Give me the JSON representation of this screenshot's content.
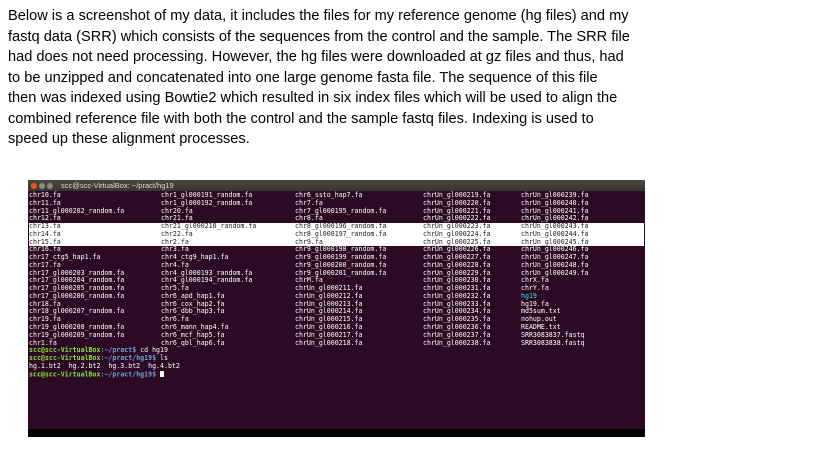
{
  "document": {
    "lines": [
      "Below is a screenshot of my data, it includes the files for my reference genome (hg files) and my",
      "fastq data (SRR) which consists of the sequences from the control and the sample. The SRR file",
      "had does not need processing.  However, the hg files were downloaded at gz files and thus, had",
      "to be unzipped and concatenated into one large genome fasta file.  The sequence of this file",
      "then was indexed using Bowtie2 which resulted in six index files which will be used to align the",
      "combined reference file with both the control and the sample fastq files.  Indexing is used to",
      "speed up these alignment processes."
    ]
  },
  "terminal": {
    "title": "scc@scc-VirtualBox: ~/pract/hg19",
    "rows": [
      [
        "chr10.fa",
        "chr1_gl000191_random.fa",
        "chr6_ssto_hap7.fa",
        "chrUn_gl000219.fa",
        "chrUn_gl000239.fa"
      ],
      [
        "chr11.fa",
        "chr1_gl000192_random.fa",
        "chr7.fa",
        "chrUn_gl000220.fa",
        "chrUn_gl000240.fa"
      ],
      [
        "chr11_gl000202_random.fa",
        "chr20.fa",
        "chr7_gl000195_random.fa",
        "chrUn_gl000221.fa",
        "chrUn_gl000241.fa"
      ],
      [
        "chr12.fa",
        "chr21.fa",
        "chr8.fa",
        "chrUn_gl000222.fa",
        "chrUn_gl000242.fa"
      ],
      [
        "chr13.fa",
        "chr21_gl000210_random.fa",
        "chr8_gl000196_random.fa",
        "chrUn_gl000223.fa",
        "chrUn_gl000243.fa"
      ],
      [
        "chr14.fa",
        "chr22.fa",
        "chr8_gl000197_random.fa",
        "chrUn_gl000224.fa",
        "chrUn_gl000244.fa"
      ],
      [
        "chr15.fa",
        "chr2.fa",
        "chr9.fa",
        "chrUn_gl000225.fa",
        "chrUn_gl000245.fa"
      ],
      [
        "chr16.fa",
        "chr3.fa",
        "chr9_gl000198_random.fa",
        "chrUn_gl000226.fa",
        "chrUn_gl000246.fa"
      ],
      [
        "chr17_ctg5_hap1.fa",
        "chr4_ctg9_hap1.fa",
        "chr9_gl000199_random.fa",
        "chrUn_gl000227.fa",
        "chrUn_gl000247.fa"
      ],
      [
        "chr17.fa",
        "chr4.fa",
        "chr9_gl000200_random.fa",
        "chrUn_gl000228.fa",
        "chrUn_gl000248.fa"
      ],
      [
        "chr17_gl000203_random.fa",
        "chr4_gl000193_random.fa",
        "chr9_gl000201_random.fa",
        "chrUn_gl000229.fa",
        "chrUn_gl000249.fa"
      ],
      [
        "chr17_gl000204_random.fa",
        "chr4_gl000194_random.fa",
        "chrM.fa",
        "chrUn_gl000230.fa",
        "chrX.fa"
      ],
      [
        "chr17_gl000205_random.fa",
        "chr5.fa",
        "chrUn_gl000211.fa",
        "chrUn_gl000231.fa",
        "chrY.fa"
      ],
      [
        "chr17_gl000206_random.fa",
        "chr6_apd_hap1.fa",
        "chrUn_gl000212.fa",
        "chrUn_gl000232.fa",
        "hg19"
      ],
      [
        "chr18.fa",
        "chr6_cox_hap2.fa",
        "chrUn_gl000213.fa",
        "chrUn_gl000233.fa",
        "hg19.fa"
      ],
      [
        "chr18_gl000207_random.fa",
        "chr6_dbb_hap3.fa",
        "chrUn_gl000214.fa",
        "chrUn_gl000234.fa",
        "md5sum.txt"
      ],
      [
        "chr19.fa",
        "chr6.fa",
        "chrUn_gl000215.fa",
        "chrUn_gl000235.fa",
        "nohup.out"
      ],
      [
        "chr19_gl000208_random.fa",
        "chr6_mann_hap4.fa",
        "chrUn_gl000216.fa",
        "chrUn_gl000236.fa",
        "README.txt"
      ],
      [
        "chr19_gl000209_random.fa",
        "chr6_mcf_hap5.fa",
        "chrUn_gl000217.fa",
        "chrUn_gl000237.fa",
        "SRR3083837.fastq"
      ],
      [
        "chr1.fa",
        "chr6_qbl_hap6.fa",
        "chrUn_gl000218.fa",
        "chrUn_gl000238.fa",
        "SRR3083838.fastq"
      ]
    ],
    "prompt_user": "scc@scc-VirtualBox",
    "lines_after": [
      {
        "prompt": "scc@scc-VirtualBox",
        "path": ":~/pract$",
        "cmd": " cd hg19"
      },
      {
        "prompt": "scc@scc-VirtualBox",
        "path": ":~/pract/hg19$",
        "cmd": " ls"
      },
      {
        "output": "hg.1.bt2  hg.2.bt2  hg.3.bt2  hg.4.bt2"
      },
      {
        "prompt": "scc@scc-VirtualBox",
        "path": ":~/pract/hg19$",
        "cmd": " "
      }
    ],
    "colors": {
      "background": "#2c0a24",
      "prompt": "#8ae234",
      "path": "#729fcf",
      "directory": "#34e2e2"
    }
  }
}
